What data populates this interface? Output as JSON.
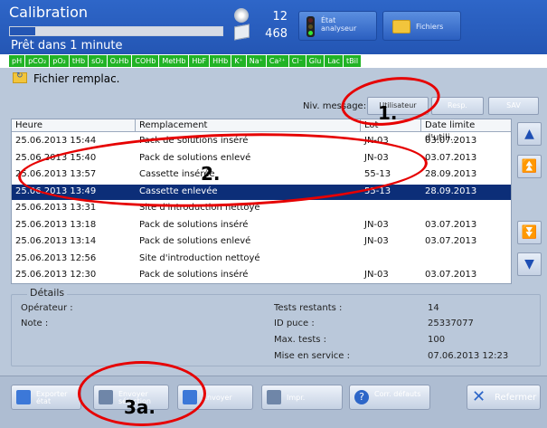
{
  "header": {
    "title": "Calibration",
    "status": "Prêt dans 1 minute",
    "progress_fraction": 0.12,
    "count_1": "12",
    "count_2": "468",
    "btn_etat": "État analyseur",
    "btn_fichiers": "Fichiers"
  },
  "params": [
    "pH",
    "pCO₂",
    "pO₂",
    "tHb",
    "sO₂",
    "O₂Hb",
    "COHb",
    "MetHb",
    "HbF",
    "HHb",
    "K⁺",
    "Na⁺",
    "Ca²⁺",
    "Cl⁻",
    "Glu",
    "Lac",
    "tBil"
  ],
  "main": {
    "title": "Fichier remplac.",
    "niv_label": "Niv. message:",
    "niv_buttons": [
      "Utilisateur",
      "Resp.",
      "SAV"
    ]
  },
  "table": {
    "headers": [
      "Heure",
      "Remplacement",
      "Lot",
      "Date limite d'utili..."
    ],
    "rows": [
      [
        "25.06.2013 15:44",
        "Pack de solutions inséré",
        "JN-03",
        "03.07.2013"
      ],
      [
        "25.06.2013 15:40",
        "Pack de solutions enlevé",
        "JN-03",
        "03.07.2013"
      ],
      [
        "25.06.2013 13:57",
        "Cassette insérée",
        "55-13",
        "28.09.2013"
      ],
      [
        "25.06.2013 13:49",
        "Cassette enlevée",
        "55-13",
        "28.09.2013"
      ],
      [
        "25.06.2013 13:31",
        "Site d'introduction nettoyé",
        "",
        ""
      ],
      [
        "25.06.2013 13:18",
        "Pack de solutions inséré",
        "JN-03",
        "03.07.2013"
      ],
      [
        "25.06.2013 13:14",
        "Pack de solutions enlevé",
        "JN-03",
        "03.07.2013"
      ],
      [
        "25.06.2013 12:56",
        "Site d'introduction nettoyé",
        "",
        ""
      ],
      [
        "25.06.2013 12:30",
        "Pack de solutions inséré",
        "JN-03",
        "03.07.2013"
      ]
    ],
    "selected_row": 3
  },
  "scroll": {
    "up": "▲",
    "page_up": "⏫",
    "page_down": "⏬",
    "down": "▼"
  },
  "details": {
    "title": "Détails",
    "operator_label": "Opérateur :",
    "note_label": "Note :",
    "fields": [
      {
        "label": "Tests restants :",
        "value": "14"
      },
      {
        "label": "ID puce :",
        "value": "25337077"
      },
      {
        "label": "Max. tests :",
        "value": "100"
      },
      {
        "label": "Mise en service :",
        "value": "07.06.2013 12:23"
      }
    ]
  },
  "bottom": {
    "export": "Exporter état",
    "envoyer_sel": "Envoyer sélection",
    "envoyer": "Envoyer",
    "impr": "Impr.",
    "corr": "Corr. défauts",
    "close": "Refermer"
  },
  "annotations": [
    "1.",
    "2.",
    "3a."
  ],
  "colors": {
    "header_blue": "#2456b4",
    "param_green": "#21b325",
    "selected_row": "#0c2e78",
    "annotation_red": "#e60000"
  }
}
